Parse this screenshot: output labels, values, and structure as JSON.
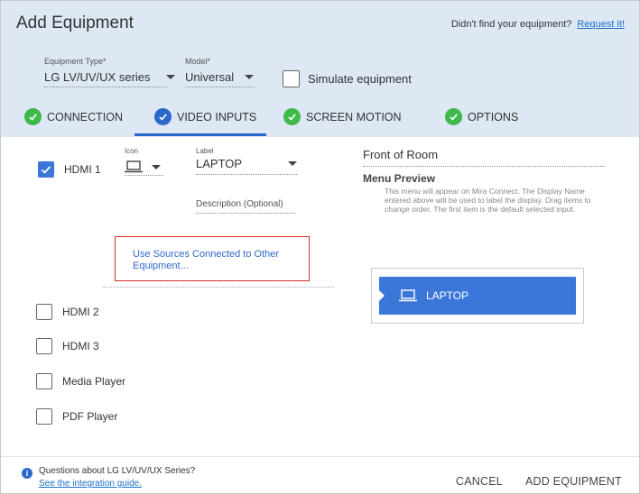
{
  "header": {
    "title": "Add Equipment",
    "missing_text": "Didn't find your equipment?",
    "request_link": "Request it!",
    "equipment_type": {
      "label": "Equipment Type*",
      "value": "LG LV/UV/UX series"
    },
    "model": {
      "label": "Model*",
      "value": "Universal"
    },
    "simulate_label": "Simulate equipment"
  },
  "tabs": [
    {
      "label": "CONNECTION",
      "check_color": "#3fb94a"
    },
    {
      "label": "VIDEO INPUTS",
      "check_color": "#2c68c9",
      "active": true
    },
    {
      "label": "SCREEN MOTION",
      "check_color": "#3fb94a"
    },
    {
      "label": "OPTIONS",
      "check_color": "#3fb94a"
    }
  ],
  "inputs": {
    "hdmi1": {
      "label": "HDMI 1",
      "checked": true
    },
    "icon_label": "Icon",
    "icon_value": "laptop-icon",
    "label_label": "Label",
    "label_value": "LAPTOP",
    "description_placeholder": "Description (Optional)",
    "use_sources": "Use Sources Connected to Other Equipment...",
    "others": [
      {
        "label": "HDMI 2",
        "checked": false
      },
      {
        "label": "HDMI 3",
        "checked": false
      },
      {
        "label": "Media Player",
        "checked": false
      },
      {
        "label": "PDF Player",
        "checked": false
      }
    ]
  },
  "right": {
    "room": "Front of Room",
    "menu_preview_title": "Menu Preview",
    "menu_preview_desc": "This menu will appear on Mira Connect.  The Display Name entered above will be used to label the display. Drag items to change order.  The first item is the default selected input.",
    "preview_item": "LAPTOP"
  },
  "footer": {
    "question": "Questions about LG LV/UV/UX Series?",
    "guide_link": "See the integration guide.",
    "cancel": "CANCEL",
    "add": "ADD EQUIPMENT"
  },
  "colors": {
    "header_bg": "#dde8f4",
    "accent": "#2c68c9",
    "green": "#3fb94a",
    "highlight_border": "#d32f2f"
  }
}
